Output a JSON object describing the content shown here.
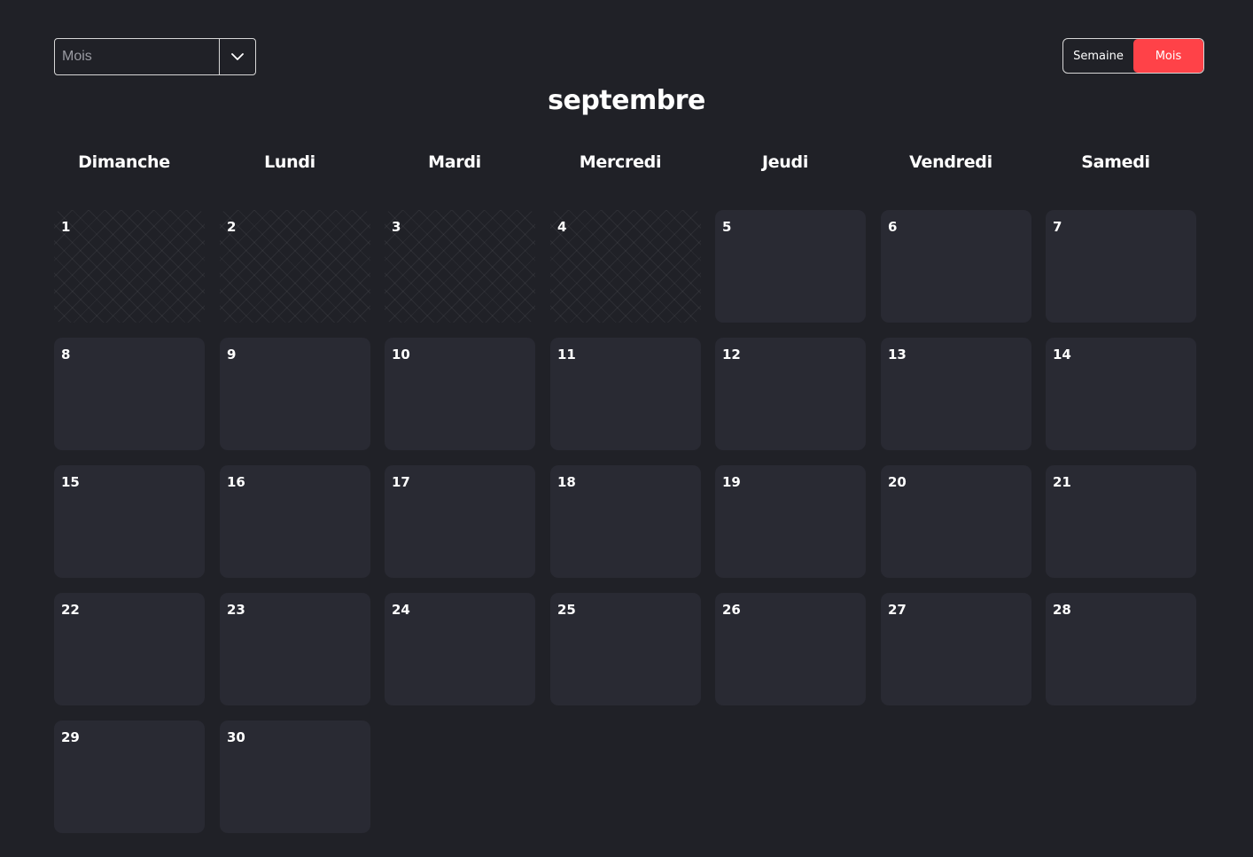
{
  "view_select": {
    "value": "Mois",
    "icon": "chevron-down-icon"
  },
  "view_toggle": {
    "week_label": "Semaine",
    "month_label": "Mois",
    "active": "Mois",
    "active_color": "#ff4248"
  },
  "calendar": {
    "month": "septembre",
    "weekdays": [
      "Dimanche",
      "Lundi",
      "Mardi",
      "Mercredi",
      "Jeudi",
      "Vendredi",
      "Samedi"
    ],
    "days": [
      "1",
      "2",
      "3",
      "4",
      "5",
      "6",
      "7",
      "8",
      "9",
      "10",
      "11",
      "12",
      "13",
      "14",
      "15",
      "16",
      "17",
      "18",
      "19",
      "20",
      "21",
      "22",
      "23",
      "24",
      "25",
      "26",
      "27",
      "28",
      "29",
      "30"
    ],
    "past_days": [
      "1",
      "2",
      "3",
      "4"
    ]
  }
}
